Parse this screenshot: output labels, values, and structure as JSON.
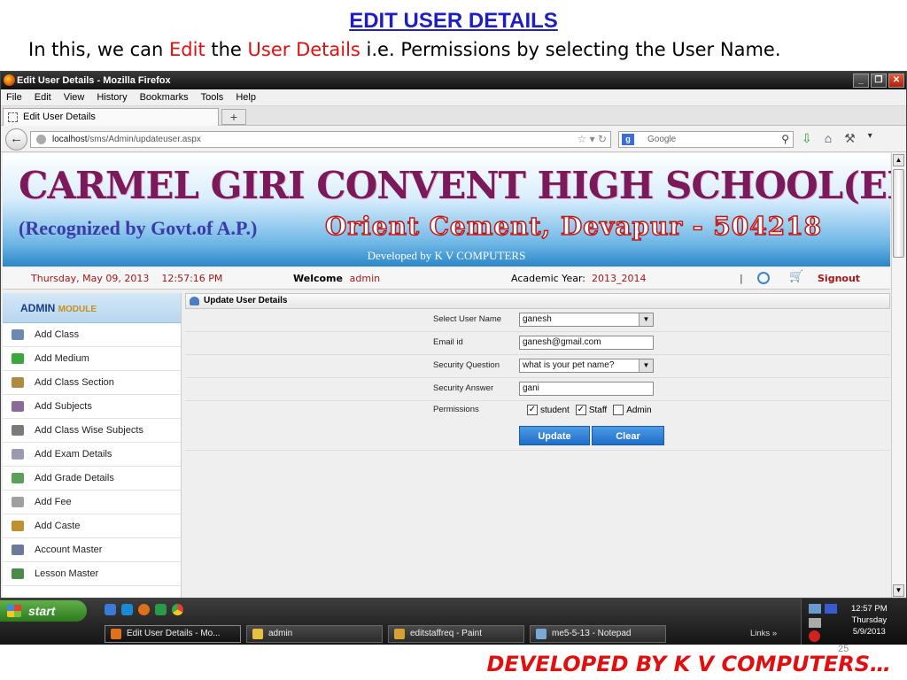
{
  "slide": {
    "title": "EDIT USER DETAILS",
    "subtitle_parts": [
      "In this, we can ",
      "Edit",
      " the ",
      "User Details",
      "  i.e. Permissions by selecting the User Name."
    ],
    "footer": "DEVELOPED BY K V COMPUTERS…",
    "page_number": "25"
  },
  "browser": {
    "window_title": "Edit User Details - Mozilla Firefox",
    "menu": [
      "File",
      "Edit",
      "View",
      "History",
      "Bookmarks",
      "Tools",
      "Help"
    ],
    "tab_title": "Edit User Details",
    "url_host": "localhost",
    "url_path": "/sms/Admin/updateuser.aspx",
    "search_placeholder": "Google"
  },
  "site": {
    "school_name": "CARMEL GIRI CONVENT HIGH SCHOOL(EM&TM)",
    "recognized": "(Recognized by Govt.of  A.P.)",
    "address": "Orient Cement, Devapur - 504218",
    "developed_by": "Developed by K V COMPUTERS",
    "date": "Thursday, May 09, 2013",
    "time": "12:57:16 PM",
    "welcome_label": "Welcome",
    "user": "admin",
    "academic_year_label": "Academic Year:",
    "academic_year": "2013_2014",
    "separator": "|",
    "signout": "Signout"
  },
  "sidebar": {
    "title": "ADMIN",
    "title_suffix": "MODULE",
    "items": [
      {
        "label": "Add Class",
        "color": "#6a8ab0"
      },
      {
        "label": "Add Medium",
        "color": "#3aa83a"
      },
      {
        "label": "Add Class Section",
        "color": "#b08a40"
      },
      {
        "label": "Add Subjects",
        "color": "#8a6a9a"
      },
      {
        "label": "Add Class Wise Subjects",
        "color": "#7a7a7a"
      },
      {
        "label": "Add Exam Details",
        "color": "#9a9ab0"
      },
      {
        "label": "Add Grade Details",
        "color": "#5aa05a"
      },
      {
        "label": "Add Fee",
        "color": "#a0a0a0"
      },
      {
        "label": "Add Caste",
        "color": "#c09030"
      },
      {
        "label": "Account Master",
        "color": "#6a7a9a"
      },
      {
        "label": "Lesson Master",
        "color": "#4a8a4a"
      }
    ]
  },
  "form": {
    "header": "Update User Details",
    "select_user_label": "Select User Name",
    "select_user_value": "ganesh",
    "email_label": "Email id",
    "email_value": "ganesh@gmail.com",
    "question_label": "Security Question",
    "question_value": "what is your pet name?",
    "answer_label": "Security Answer",
    "answer_value": "gani",
    "permissions_label": "Permissions",
    "permissions": [
      {
        "label": "student",
        "checked": true
      },
      {
        "label": "Staff",
        "checked": true
      },
      {
        "label": "Admin",
        "checked": false
      }
    ],
    "update_button": "Update",
    "clear_button": "Clear"
  },
  "taskbar": {
    "start": "start",
    "tasks": [
      {
        "label": "Edit User Details - Mo...",
        "active": true
      },
      {
        "label": "admin",
        "active": false
      },
      {
        "label": "editstaffreq - Paint",
        "active": false
      },
      {
        "label": "me5-5-13 - Notepad",
        "active": false
      }
    ],
    "links": "Links",
    "clock_time": "12:57 PM",
    "clock_day": "Thursday",
    "clock_date": "5/9/2013"
  }
}
